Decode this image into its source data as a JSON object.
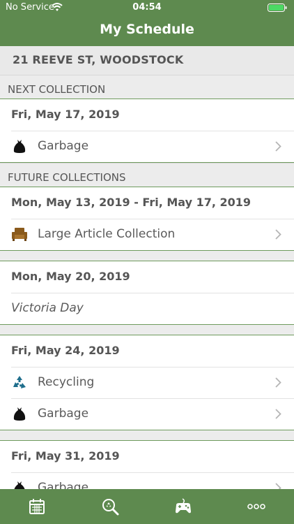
{
  "status_bar": {
    "carrier": "No Service",
    "time": "04:54"
  },
  "header": {
    "title": "My Schedule"
  },
  "address": "21 REEVE ST, WOODSTOCK",
  "next_collection": {
    "header": "NEXT COLLECTION",
    "date": "Fri, May 17, 2019",
    "items": [
      {
        "icon": "garbage-bag-icon",
        "label": "Garbage"
      }
    ]
  },
  "future_collections": {
    "header": "FUTURE COLLECTIONS",
    "groups": [
      {
        "date": "Mon, May 13, 2019 - Fri, May 17, 2019",
        "items": [
          {
            "icon": "armchair-icon",
            "label": "Large Article Collection"
          }
        ]
      },
      {
        "date": "Mon, May 20, 2019",
        "holiday": "Victoria Day"
      },
      {
        "date": "Fri, May 24, 2019",
        "items": [
          {
            "icon": "recycling-icon",
            "label": "Recycling"
          },
          {
            "icon": "garbage-bag-icon",
            "label": "Garbage"
          }
        ]
      },
      {
        "date": "Fri, May 31, 2019",
        "items": [
          {
            "icon": "garbage-bag-icon",
            "label": "Garbage"
          }
        ]
      }
    ]
  },
  "colors": {
    "brand_green": "#5e8a4f",
    "card_border": "#6e9a5d",
    "recycle_blue": "#1f6e8c",
    "armchair_brown": "#8a5a1c"
  },
  "tabbar": {
    "tabs": [
      "calendar-icon",
      "search-icon",
      "game-controller-icon",
      "more-icon"
    ]
  }
}
